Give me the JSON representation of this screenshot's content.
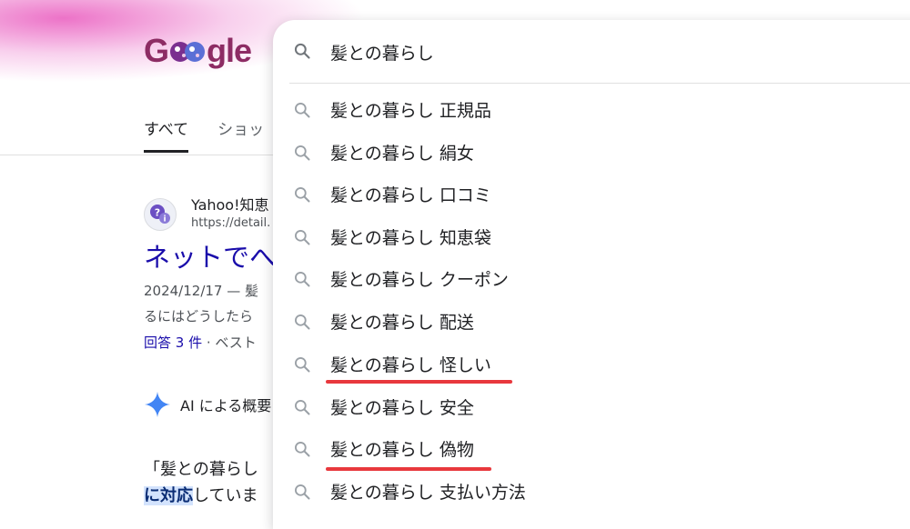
{
  "logo": {
    "text_pre": "G",
    "text_post": "gle"
  },
  "tabs": [
    {
      "label": "すべて",
      "active": true
    },
    {
      "label": "ショッ",
      "active": false
    }
  ],
  "result": {
    "site_name": "Yahoo!知恵",
    "url": "https://detail.",
    "title": "ネットでへ",
    "snippet_line1": "2024/12/17 — 髪",
    "snippet_line2": "るにはどうしたら",
    "answers_link": "回答 3 件",
    "answers_rest": " · ベスト"
  },
  "ai_overview": {
    "label": "AI による概要"
  },
  "body_text": {
    "line1": "「髪との暮らし",
    "line2_highlight": "に対応",
    "line2_rest": "していま"
  },
  "search": {
    "query": "髪との暮らし",
    "icon": "search-icon"
  },
  "suggestions": [
    {
      "text": "髪との暮らし 正規品",
      "underlined": false
    },
    {
      "text": "髪との暮らし 絹女",
      "underlined": false
    },
    {
      "text": "髪との暮らし 口コミ",
      "underlined": false
    },
    {
      "text": "髪との暮らし 知恵袋",
      "underlined": false
    },
    {
      "text": "髪との暮らし クーポン",
      "underlined": false
    },
    {
      "text": "髪との暮らし 配送",
      "underlined": false
    },
    {
      "text": "髪との暮らし 怪しい",
      "underlined": true
    },
    {
      "text": "髪との暮らし 安全",
      "underlined": false
    },
    {
      "text": "髪との暮らし 偽物",
      "underlined": true
    },
    {
      "text": "髪との暮らし 支払い方法",
      "underlined": false
    }
  ],
  "colors": {
    "link": "#1a0dab",
    "underline_annotation": "#e8383d",
    "logo": "#8d2c64",
    "ai_sparkle": "#4285f4"
  }
}
